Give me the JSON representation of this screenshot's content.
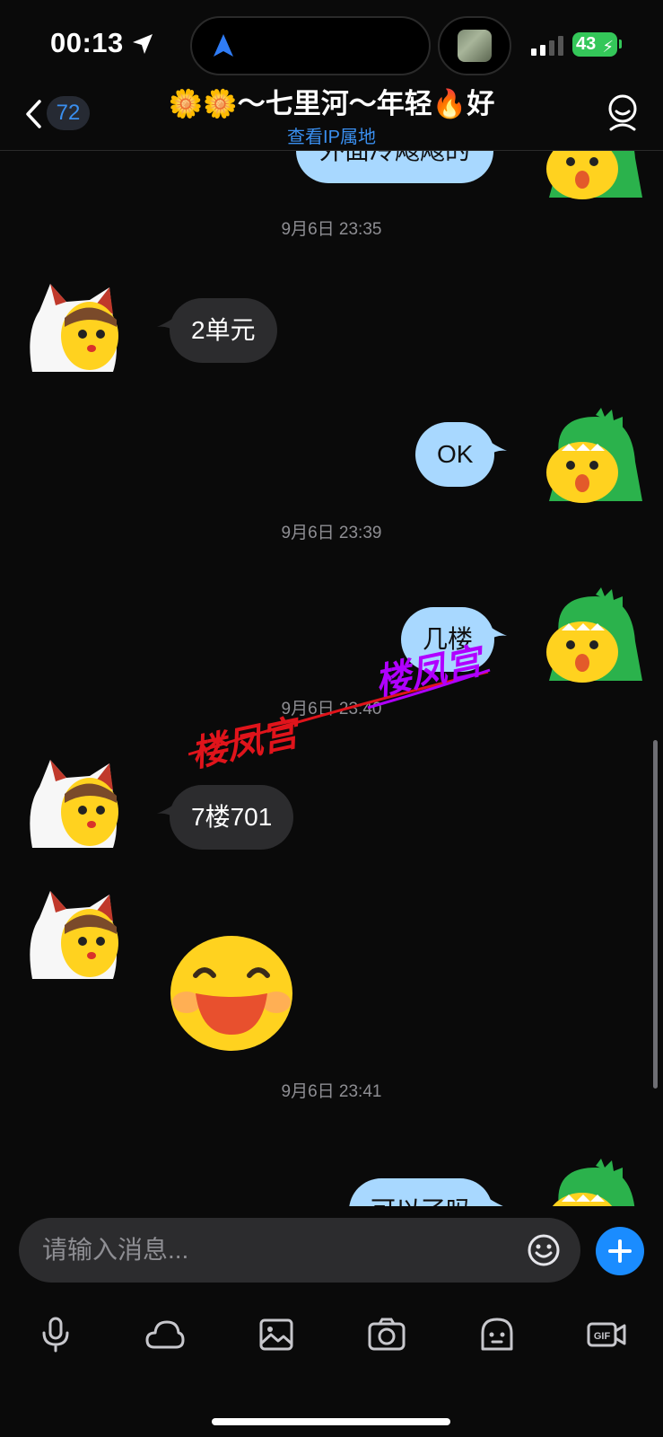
{
  "status_bar": {
    "time": "00:13",
    "battery": "43"
  },
  "header": {
    "back_count": "72",
    "title": "🌼🌼～七里河～年轻🔥好",
    "subtitle": "查看IP属地"
  },
  "messages": {
    "top_partial_out": "外面冷飕飕的",
    "ts1": "9月6日 23:35",
    "in1": "2单元",
    "out1": "OK",
    "ts2": "9月6日 23:39",
    "out2": "几楼",
    "ts3": "9月6日 23:40",
    "in2": "7楼701",
    "ts4": "9月6日 23:41",
    "bottom_partial_out": "可以了吗"
  },
  "watermark": {
    "text1": "楼凤宫",
    "text2": "楼凤宫",
    "color1": "#e0141b",
    "color2": "#b000ff"
  },
  "input": {
    "placeholder": "请输入消息..."
  },
  "toolbar": {
    "icons": [
      "mic-icon",
      "cloud-icon",
      "image-icon",
      "camera-icon",
      "sticker-icon",
      "gif-icon"
    ]
  },
  "colors": {
    "accent": "#1a8cff",
    "bubble_out": "#a8d8ff",
    "bubble_in": "#2c2c2e",
    "battery": "#34c759"
  }
}
